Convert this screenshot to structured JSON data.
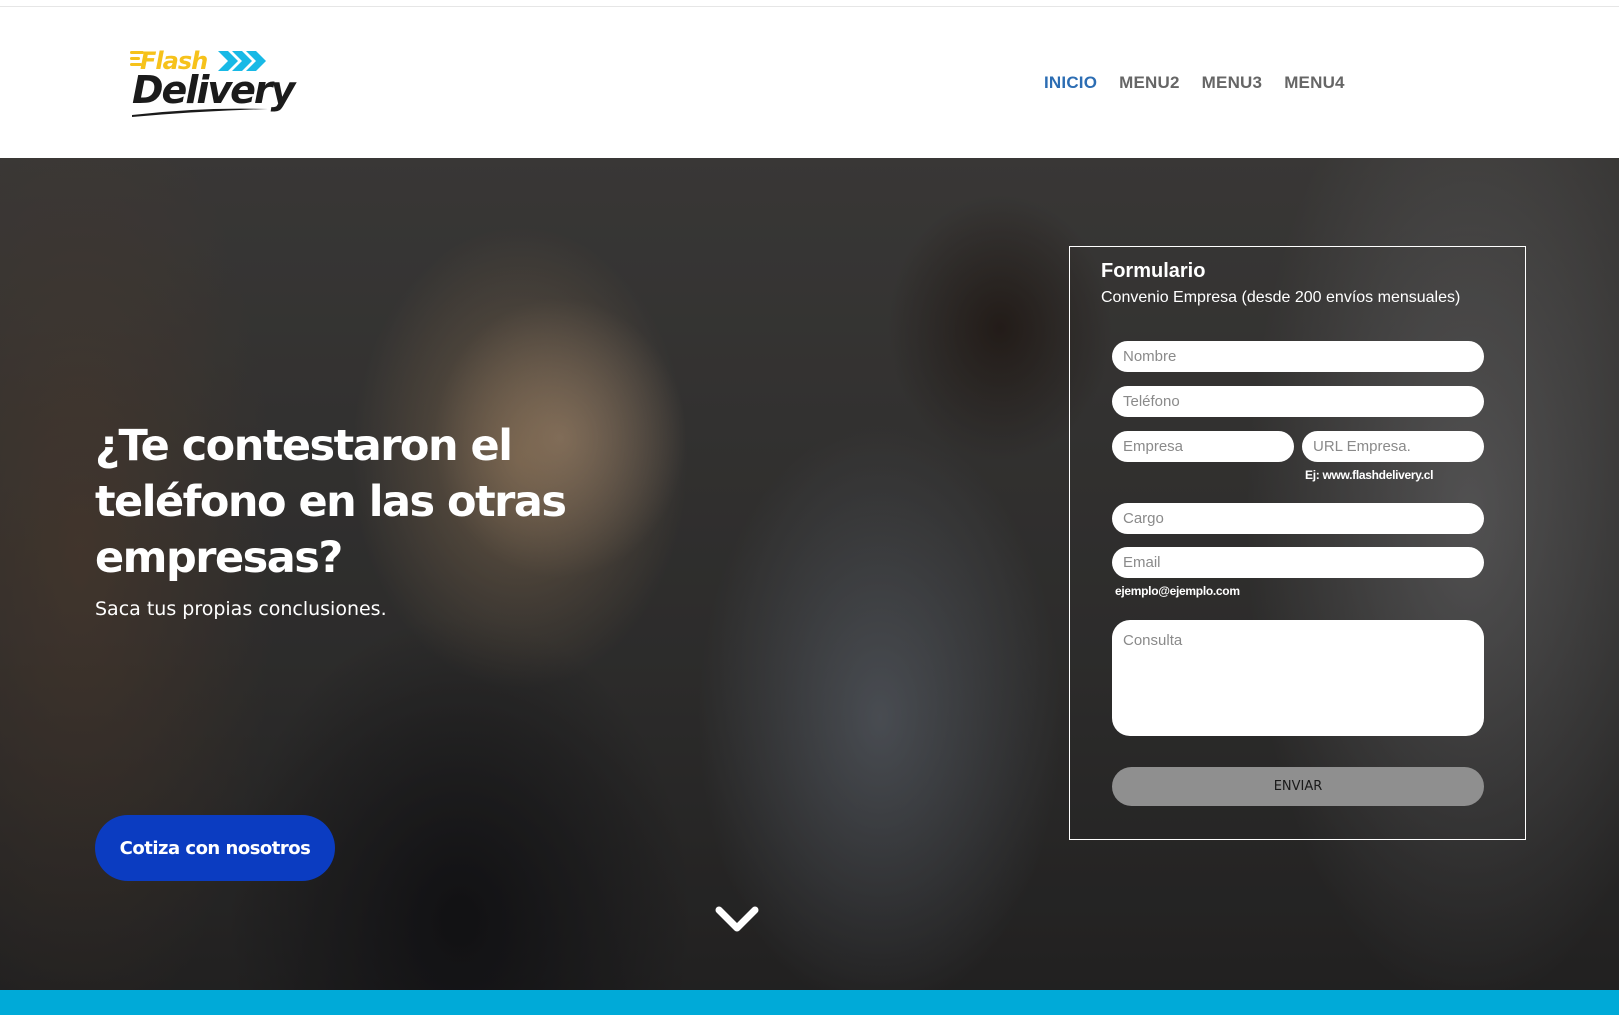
{
  "brand": {
    "logo_word1": "Flash",
    "logo_word2": "Delivery",
    "colors": {
      "yellow": "#f6c21b",
      "cyan": "#18b9e6",
      "dark": "#1b1b1b"
    }
  },
  "nav": {
    "items": [
      {
        "label": "INICIO",
        "active": true
      },
      {
        "label": "MENU2"
      },
      {
        "label": "MENU3"
      },
      {
        "label": "MENU4"
      }
    ],
    "active_color": "#2c6db3",
    "color": "#666666"
  },
  "hero": {
    "title": "¿Te contestaron el teléfono en las otras empresas?",
    "subtitle": "Saca tus propias conclusiones.",
    "cta_label": "Cotiza con nosotros",
    "cta_color": "#0b3cc1",
    "scroll_icon": "chevron-down-icon"
  },
  "form": {
    "title": "Formulario",
    "subtitle": "Convenio Empresa (desde 200 envíos mensuales)",
    "fields": {
      "nombre": {
        "placeholder": "Nombre"
      },
      "telefono": {
        "placeholder": "Teléfono"
      },
      "empresa": {
        "placeholder": "Empresa"
      },
      "url": {
        "placeholder": "URL Empresa.",
        "hint": "Ej: www.flashdelivery.cl"
      },
      "cargo": {
        "placeholder": "Cargo"
      },
      "email": {
        "placeholder": "Email",
        "hint": "ejemplo@ejemplo.com"
      },
      "consulta": {
        "placeholder": "Consulta"
      }
    },
    "submit_label": "ENVIAR"
  },
  "footer_band": {
    "color": "#00aad8"
  }
}
